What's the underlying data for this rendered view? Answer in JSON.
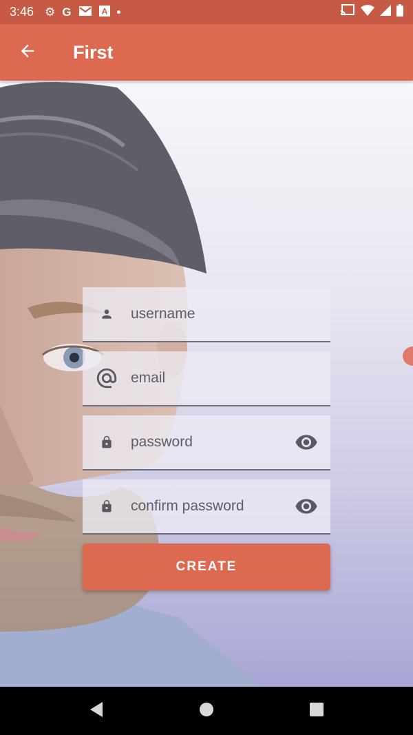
{
  "status_bar": {
    "time": "3:46",
    "left_icons": [
      "gear-icon",
      "google-icon",
      "gmail-icon",
      "a-box-icon",
      "dot-icon"
    ],
    "left_glyphs": [
      "⚙",
      "G",
      "M",
      "A",
      "•"
    ],
    "right_icons": [
      "cast-icon",
      "wifi-icon",
      "signal-icon",
      "battery-icon"
    ]
  },
  "app_bar": {
    "title": "First",
    "back_icon": "arrow-left-icon",
    "color": "#dd6a50"
  },
  "form": {
    "fields": [
      {
        "name": "username",
        "placeholder": "username",
        "lead_icon": "person-icon",
        "trail_icon": null
      },
      {
        "name": "email",
        "placeholder": "email",
        "lead_icon": "at-icon",
        "trail_icon": null
      },
      {
        "name": "password",
        "placeholder": "password",
        "lead_icon": "lock-icon",
        "trail_icon": "eye-icon"
      },
      {
        "name": "confirm-password",
        "placeholder": "confirm password",
        "lead_icon": "lock-icon",
        "trail_icon": "eye-icon"
      }
    ],
    "submit_label": "CREATE",
    "accent_color": "#dd6a50"
  },
  "nav_bar": {
    "buttons": [
      "back-triangle-icon",
      "home-circle-icon",
      "recents-square-icon"
    ]
  }
}
